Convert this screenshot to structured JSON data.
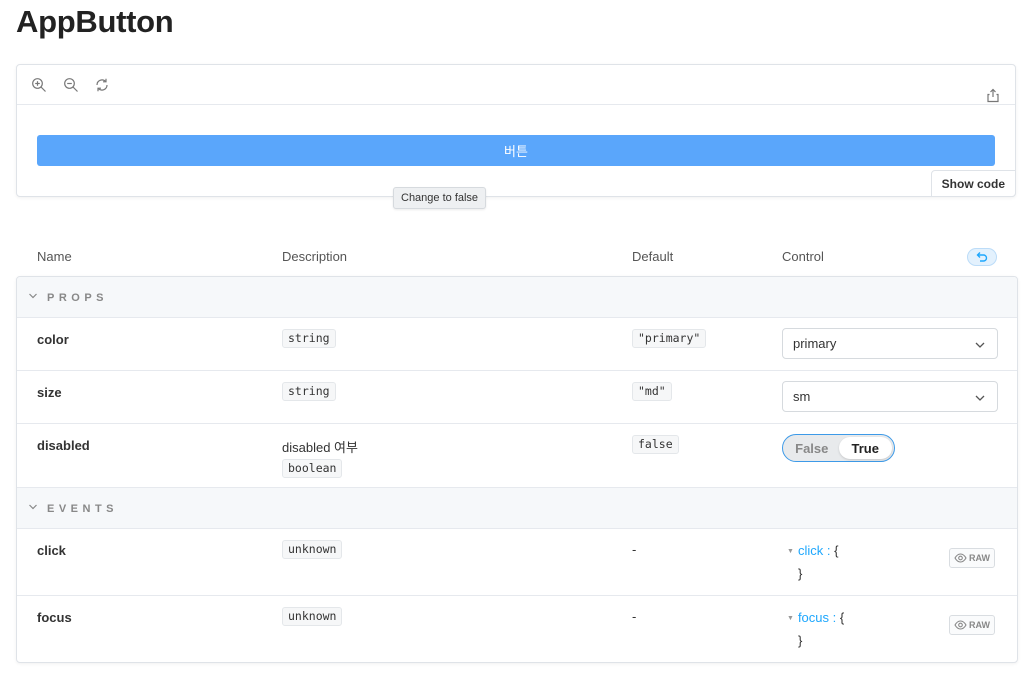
{
  "page": {
    "title": "AppButton"
  },
  "preview": {
    "toolbar": {
      "zoom_in": "zoom-in-icon",
      "zoom_out": "zoom-out-icon",
      "reset": "reset-zoom-icon",
      "share": "share-icon"
    },
    "button_label": "버튼",
    "show_code": "Show code",
    "button_color": "#5aa6fb"
  },
  "tooltip": "Change to false",
  "table": {
    "headers": {
      "name": "Name",
      "description": "Description",
      "default": "Default",
      "control": "Control"
    },
    "sections": {
      "props": "PROPS",
      "events": "EVENTS"
    },
    "props": [
      {
        "name": "color",
        "description": "",
        "type": "string",
        "default": "\"primary\"",
        "control": "primary"
      },
      {
        "name": "size",
        "description": "",
        "type": "string",
        "default": "\"md\"",
        "control": "sm"
      },
      {
        "name": "disabled",
        "description": "disabled 여부",
        "type": "boolean",
        "default": "false",
        "control_options": [
          "False",
          "True"
        ],
        "control_value": "True"
      }
    ],
    "events": [
      {
        "name": "click",
        "type": "unknown",
        "default": "-",
        "key": "click",
        "raw": "RAW"
      },
      {
        "name": "focus",
        "type": "unknown",
        "default": "-",
        "key": "focus",
        "raw": "RAW"
      }
    ]
  },
  "accent_color": "#1ea7fd"
}
